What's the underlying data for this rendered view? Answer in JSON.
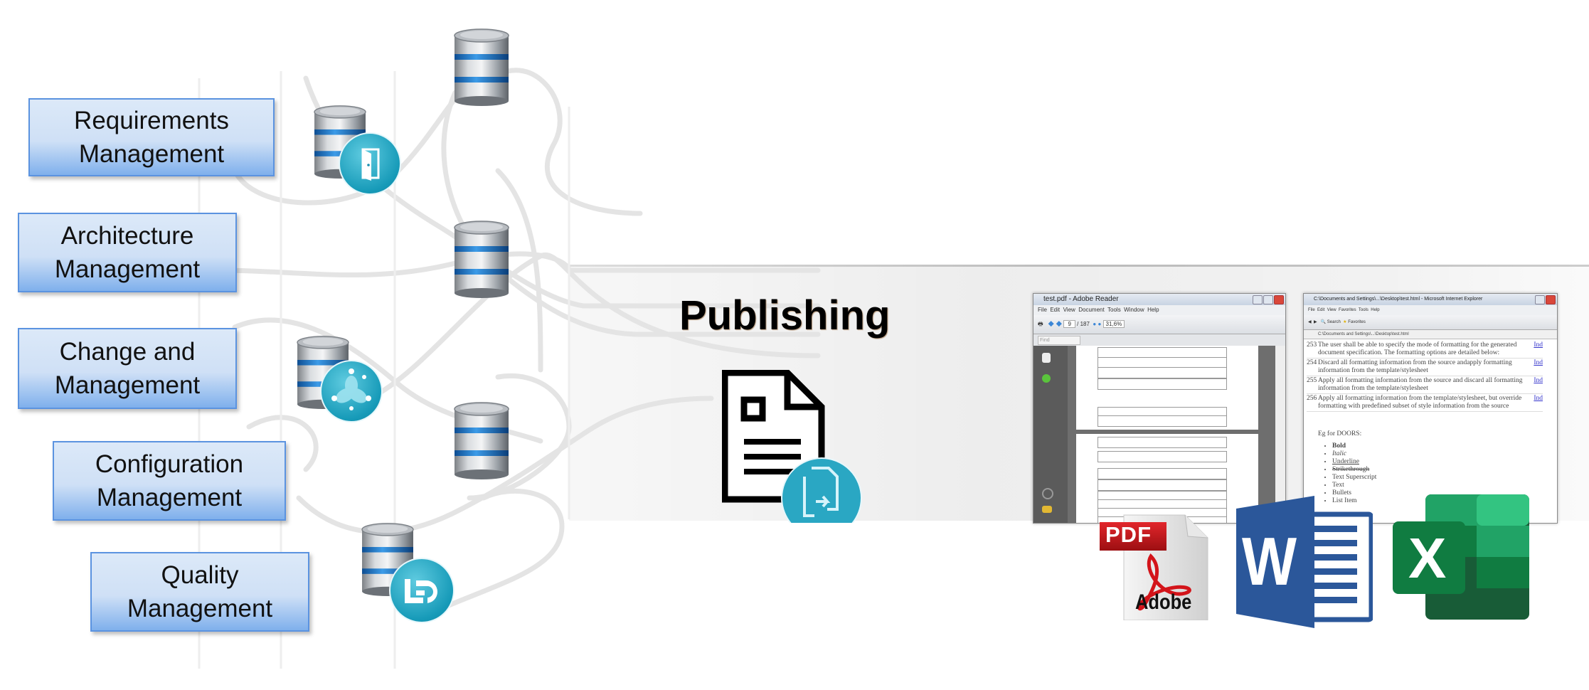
{
  "diagram": {
    "sources": [
      {
        "id": "requirements",
        "line1": "Requirements",
        "line2": "Management"
      },
      {
        "id": "architecture",
        "line1": "Architecture",
        "line2": "Management"
      },
      {
        "id": "change",
        "line1": "Change and",
        "line2": "Management"
      },
      {
        "id": "configuration",
        "line1": "Configuration",
        "line2": "Management"
      },
      {
        "id": "quality",
        "line1": "Quality",
        "line2": "Management"
      }
    ],
    "databases": [
      {
        "id": "db-top",
        "badge": null
      },
      {
        "id": "db-requirements",
        "badge": "door-icon"
      },
      {
        "id": "db-middle",
        "badge": null
      },
      {
        "id": "db-change",
        "badge": "network-flower-icon"
      },
      {
        "id": "db-lower",
        "badge": null
      },
      {
        "id": "db-quality",
        "badge": "quality-logo-icon"
      }
    ],
    "publishing": {
      "title": "Publishing",
      "icon": "document-export-icon"
    },
    "outputs": {
      "adobe_window": {
        "title": "test.pdf - Adobe Reader",
        "menu": [
          "File",
          "Edit",
          "View",
          "Document",
          "Tools",
          "Window",
          "Help"
        ],
        "page_current": "9",
        "page_total": "/ 187",
        "zoom": "31,6%",
        "find_placeholder": "Find"
      },
      "ie_window": {
        "title": "C:\\Documents and Settings\\...\\Desktop\\test.html - Microsoft Internet Explorer",
        "menu": [
          "File",
          "Edit",
          "View",
          "Favorites",
          "Tools",
          "Help"
        ],
        "address": "C:\\Documents and Settings\\...\\Desktop\\test.html",
        "search_label": "Search",
        "favorites_label": "Favorites",
        "rows": [
          {
            "num": "253",
            "text": "The user shall be able to specify the mode of formatting for the generated document specification. The formatting options are detailed below:",
            "link": "Ind"
          },
          {
            "num": "254",
            "text": "Discard all formatting information from the source andapply formatting information from the template/stylesheet",
            "link": "Ind"
          },
          {
            "num": "255",
            "text": "Apply all formatting information from the source and discard all formatting information from the template/stylesheet",
            "link": "Ind"
          },
          {
            "num": "256",
            "text": "Apply all formatting information from the template/stylesheet, but override formatting with predefined subset of style information from the source",
            "link": "Ind"
          }
        ],
        "eg_label": "Eg for DOORS:",
        "bullets": [
          "Bold",
          "Italic",
          "Underline",
          "Strikethrough",
          "Text Superscript",
          "Text",
          "Bullets",
          "List Item"
        ]
      },
      "formats": [
        {
          "id": "pdf",
          "label": "PDF",
          "brand": "Adobe",
          "color": "#c8171c"
        },
        {
          "id": "word",
          "label": "W",
          "color": "#2b579a"
        },
        {
          "id": "excel",
          "label": "X",
          "color": "#107c41"
        }
      ]
    }
  }
}
